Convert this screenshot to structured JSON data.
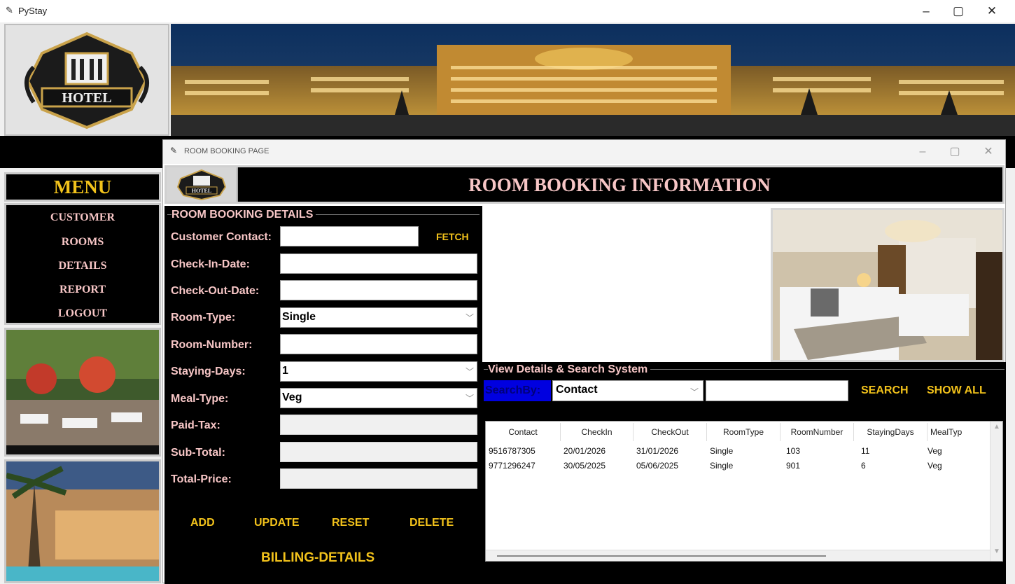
{
  "app": {
    "title": "PyStay"
  },
  "menu": {
    "title": "MENU",
    "items": [
      "CUSTOMER",
      "ROOMS",
      "DETAILS",
      "REPORT",
      "LOGOUT"
    ]
  },
  "logo": {
    "text": "HOTEL"
  },
  "child_window": {
    "title": "ROOM BOOKING PAGE",
    "header": "ROOM BOOKING INFORMATION"
  },
  "form": {
    "group_title": "ROOM BOOKING DETAILS",
    "fetch_label": "FETCH",
    "fields": {
      "customer_contact": {
        "label": "Customer Contact:",
        "value": ""
      },
      "check_in": {
        "label": "Check-In-Date:",
        "value": ""
      },
      "check_out": {
        "label": "Check-Out-Date:",
        "value": ""
      },
      "room_type": {
        "label": "Room-Type:",
        "value": "Single"
      },
      "room_number": {
        "label": "Room-Number:",
        "value": ""
      },
      "staying_days": {
        "label": "Staying-Days:",
        "value": "1"
      },
      "meal_type": {
        "label": "Meal-Type:",
        "value": "Veg"
      },
      "paid_tax": {
        "label": "Paid-Tax:",
        "value": ""
      },
      "sub_total": {
        "label": "Sub-Total:",
        "value": ""
      },
      "total_price": {
        "label": "Total-Price:",
        "value": ""
      }
    },
    "buttons": {
      "add": "ADD",
      "update": "UPDATE",
      "reset": "RESET",
      "delete": "DELETE",
      "billing": "BILLING-DETAILS"
    }
  },
  "search": {
    "group_title": "View Details & Search System",
    "search_by_label": "SearchBy:",
    "search_by_value": "Contact",
    "search_text": "",
    "search_button": "SEARCH",
    "show_all_button": "SHOW ALL"
  },
  "table": {
    "columns": [
      "Contact",
      "CheckIn",
      "CheckOut",
      "RoomType",
      "RoomNumber",
      "StayingDays",
      "MealTyp"
    ],
    "rows": [
      [
        "9516787305",
        "20/01/2026",
        "31/01/2026",
        "Single",
        "103",
        "11",
        "Veg"
      ],
      [
        "9771296247",
        "30/05/2025",
        "05/06/2025",
        "Single",
        "901",
        "6",
        "Veg"
      ]
    ]
  },
  "colors": {
    "gold": "#f2c21b",
    "pink": "#f7c6c6",
    "black": "#000000",
    "search_by_bg": "#0000e0"
  },
  "window_controls": {
    "minimize": "–",
    "maximize": "▢",
    "close": "✕"
  }
}
